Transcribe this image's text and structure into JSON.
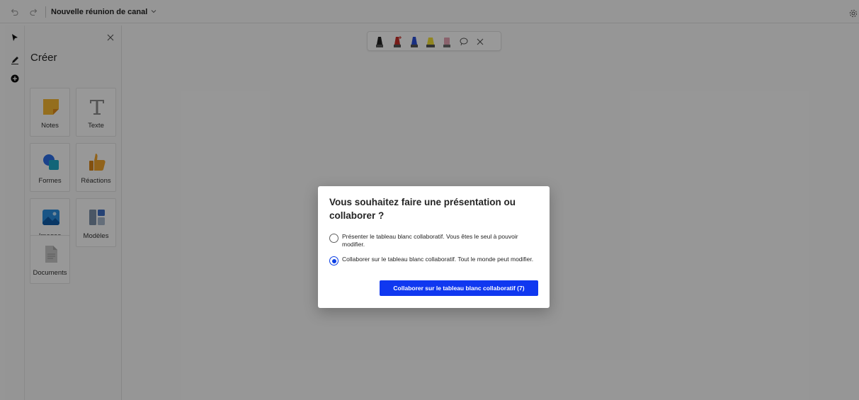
{
  "header": {
    "title": "Nouvelle réunion de canal",
    "icons": [
      "undo-icon",
      "redo-icon",
      "chevron-down-icon",
      "settings-icon"
    ]
  },
  "left_strip": {
    "tools": [
      "select-arrow-icon",
      "pen-icon",
      "add-icon"
    ]
  },
  "create_panel": {
    "title": "Créer",
    "items": [
      {
        "label": "Notes",
        "icon": "sticky-note-icon"
      },
      {
        "label": "Texte",
        "icon": "text-icon"
      },
      {
        "label": "Formes",
        "icon": "shapes-icon"
      },
      {
        "label": "Réactions",
        "icon": "thumbs-up-icon"
      },
      {
        "label": "Images",
        "icon": "image-icon"
      },
      {
        "label": "Modèles",
        "icon": "templates-icon"
      },
      {
        "label": "Documents",
        "icon": "document-icon"
      }
    ]
  },
  "pen_toolbar": {
    "pens": [
      "black-pen-icon",
      "red-pen-icon",
      "blue-pen-icon",
      "yellow-highlighter-icon",
      "eraser-icon"
    ],
    "extras": [
      "lasso-icon",
      "close-icon"
    ]
  },
  "dialog": {
    "title": "Vous souhaitez faire une présentation ou collaborer ?",
    "options": [
      {
        "label": "Présenter le tableau blanc collaboratif. Vous êtes le seul à pouvoir modifier.",
        "selected": false
      },
      {
        "label": "Collaborer sur le tableau blanc collaboratif. Tout le monde peut modifier.",
        "selected": true
      }
    ],
    "primary_button": "Collaborer sur le tableau blanc collaboratif (7)"
  },
  "colors": {
    "accent": "#1038f0",
    "overlay": "rgba(0,0,0,0.4)"
  }
}
